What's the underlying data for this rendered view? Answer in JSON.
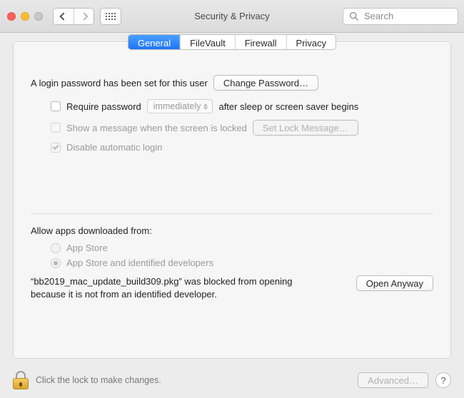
{
  "window": {
    "title": "Security & Privacy",
    "search_placeholder": "Search"
  },
  "tabs": {
    "general": "General",
    "filevault": "FileVault",
    "firewall": "Firewall",
    "privacy": "Privacy",
    "active": "general"
  },
  "login": {
    "password_set_text": "A login password has been set for this user",
    "change_password_label": "Change Password…",
    "require_password_label": "Require password",
    "require_delay_value": "immediately",
    "require_suffix": "after sleep or screen saver begins",
    "show_message_label": "Show a message when the screen is locked",
    "set_lock_message_label": "Set Lock Message…",
    "disable_autologin_label": "Disable automatic login"
  },
  "downloads": {
    "heading": "Allow apps downloaded from:",
    "opt_appstore": "App Store",
    "opt_identified": "App Store and identified developers",
    "selected": "identified",
    "blocked_text": "“bb2019_mac_update_build309.pkg” was blocked from opening because it is not from an identified developer.",
    "open_anyway_label": "Open Anyway"
  },
  "footer": {
    "lock_hint": "Click the lock to make changes.",
    "advanced_label": "Advanced…",
    "help_label": "?"
  }
}
